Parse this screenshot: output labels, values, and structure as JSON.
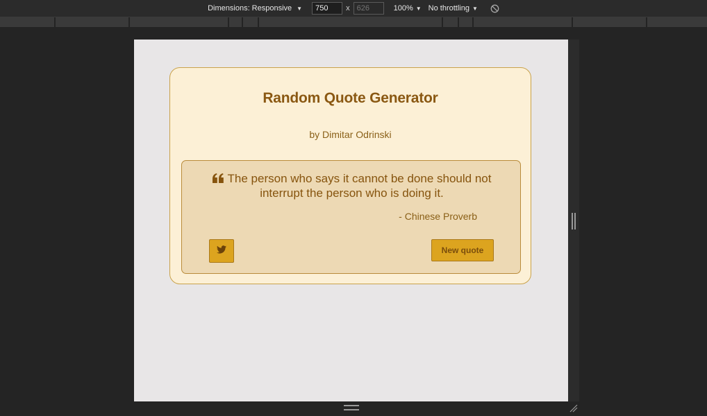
{
  "devtools": {
    "dimensions_label": "Dimensions: Responsive",
    "width_value": "750",
    "height_placeholder": "626",
    "times": "x",
    "zoom": "100%",
    "throttling": "No throttling",
    "icons": {
      "dropdown": "caret-down-icon",
      "rotate": "rotate-icon"
    }
  },
  "app": {
    "title": "Random Quote Generator",
    "byline": "by Dimitar Odrinski",
    "quote": {
      "text": "The person who says it cannot be done should not interrupt the person who is doing it.",
      "author": "- Chinese Proverb"
    },
    "buttons": {
      "tweet_icon": "twitter-icon",
      "new_quote": "New quote"
    },
    "colors": {
      "title": "#8a5812",
      "card_bg": "#fcf0d6",
      "quote_bg": "#edd9b4",
      "accent": "#dca41f"
    }
  }
}
